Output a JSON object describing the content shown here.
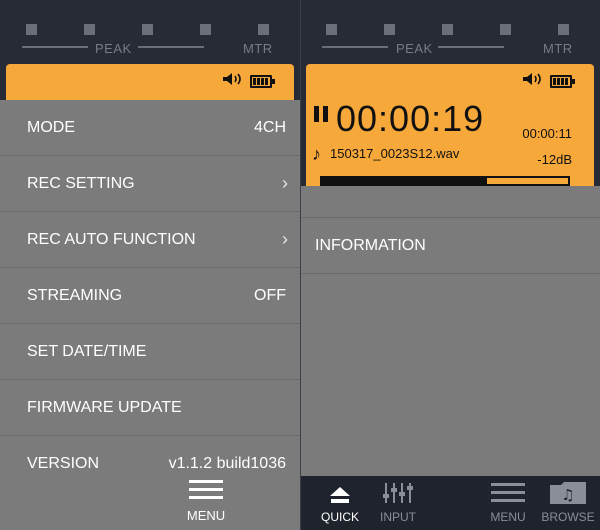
{
  "meters": {
    "peak": "PEAK",
    "mtr": "MTR"
  },
  "menu": {
    "items": [
      {
        "label": "MODE",
        "value": "4CH"
      },
      {
        "label": "REC SETTING"
      },
      {
        "label": "REC AUTO FUNCTION"
      },
      {
        "label": "STREAMING",
        "value": "OFF"
      },
      {
        "label": "SET DATE/TIME"
      },
      {
        "label": "FIRMWARE UPDATE"
      },
      {
        "label": "VERSION",
        "value": "v1.1.2 build1036"
      }
    ],
    "button_label": "MENU"
  },
  "display": {
    "time": "00:00:19",
    "remaining": "00:00:11",
    "filename": "150317_0023S12.wav",
    "level": "-12dB",
    "progress": 0.67
  },
  "right_menu": {
    "items": [
      {
        "label": "INFORMATION"
      }
    ]
  },
  "tabs": [
    {
      "label": "QUICK",
      "active": true
    },
    {
      "label": "INPUT"
    },
    {
      "label": "MENU"
    },
    {
      "label": "BROWSE"
    }
  ],
  "colors": {
    "lcd": "#f7a83a",
    "menu_bg": "#7b7b7b",
    "bar_bg": "#1f232c"
  }
}
